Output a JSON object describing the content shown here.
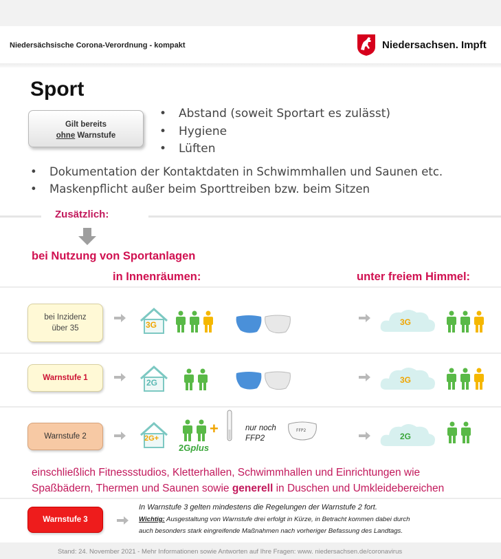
{
  "header": {
    "title": "Niedersächsische Corona-Verordnung - kompakt",
    "brand": "Niedersachsen. Impft"
  },
  "section": {
    "title": "Sport",
    "badge_line1": "Gilt bereits",
    "badge_line2_u": "ohne",
    "badge_line2_rest": " Warnstufe",
    "bullets_right": [
      "Abstand (soweit Sportart es zulässt)",
      "Hygiene",
      "Lüften"
    ],
    "bullets_full": [
      "Dokumentation der Kontaktdaten in Schwimmhallen und Saunen etc.",
      "Maskenpflicht außer beim Sporttreiben bzw. beim Sitzen"
    ]
  },
  "zusaetzlich": "Zusätzlich:",
  "nutzung": "bei Nutzung von Sportanlagen",
  "innen": "in Innenräumen:",
  "frei": "unter freiem Himmel:",
  "levels": {
    "inz_line1": "bei Inzidenz",
    "inz_line2": "über 35",
    "ws1": "Warnstufe 1",
    "ws2": "Warnstufe 2",
    "ws3": "Warnstufe 3"
  },
  "rules": {
    "g3": "3G",
    "g2": "2G",
    "g2plus_house": "2G+",
    "g2plus_main": "2G",
    "g2plus_suffix": "plus",
    "nur_noch": "nur noch",
    "ffp2": "FFP2",
    "mask_label": "FFP2"
  },
  "einschl_line1": "einschließlich Fitnessstudios, Kletterhallen, Schwimmhallen und Einrichtungen wie",
  "einschl_line2_a": "Spaßbädern, Thermen und Saunen sowie ",
  "einschl_line2_b": "generell",
  "einschl_line2_c": " in Duschen und Umkleidebereichen",
  "ws3": {
    "line1": "In Warnstufe 3 gelten mindestens die Regelungen der Warnstufe 2 fort.",
    "line2_u": "Wichtig:",
    "line2_rest": " Ausgestaltung von Warnstufe drei erfolgt in Kürze, in Betracht kommen dabei durch",
    "line3": "auch besonders stark eingreifende Maßnahmen nach vorheriger Befassung des Landtags."
  },
  "footer": "Stand: 24. November 2021 - Mehr Informationen sowie Antworten auf Ihre Fragen: www. niedersachsen.de/coronavirus",
  "colors": {
    "accent": "#d01050",
    "green": "#3aa63a",
    "teal": "#5ab9b3",
    "yellow": "#f5b700",
    "warn3": "#ee1c1c"
  },
  "icons": [
    "horse-logo-icon",
    "arrow-right-icon",
    "arrow-down-icon",
    "house-icon",
    "person-icon",
    "cloud-icon",
    "mask-icon",
    "test-swab-icon"
  ]
}
